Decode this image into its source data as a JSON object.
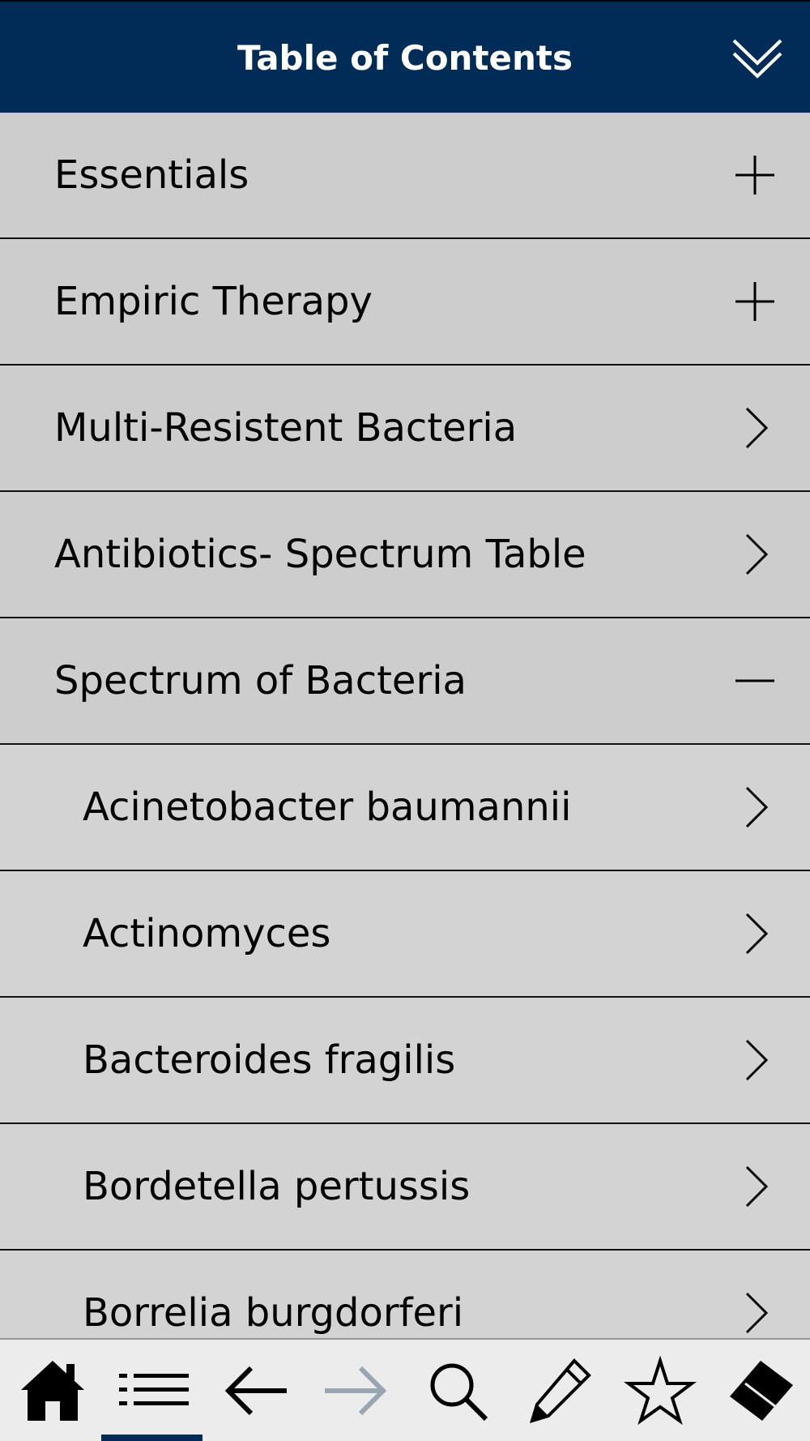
{
  "header": {
    "title": "Table of Contents",
    "collapse_icon": "double-chevron-down-icon"
  },
  "colors": {
    "header_bg": "#002c57",
    "header_text": "#ffffff",
    "row_bg": "#d3d3d3",
    "row_text": "#000000",
    "disabled_icon": "#9aa6b2",
    "active_indicator": "#002c57"
  },
  "toc": {
    "items": [
      {
        "label": "Essentials",
        "level": "top",
        "icon": "plus-icon"
      },
      {
        "label": "Empiric Therapy",
        "level": "top",
        "icon": "plus-icon"
      },
      {
        "label": "Multi-Resistent Bacteria",
        "level": "top",
        "icon": "chevron-right-icon"
      },
      {
        "label": "Antibiotics- Spectrum Table",
        "level": "top",
        "icon": "chevron-right-icon"
      },
      {
        "label": "Spectrum of Bacteria",
        "level": "top",
        "icon": "minus-icon"
      },
      {
        "label": "Acinetobacter baumannii",
        "level": "sub",
        "icon": "chevron-right-icon"
      },
      {
        "label": "Actinomyces",
        "level": "sub",
        "icon": "chevron-right-icon"
      },
      {
        "label": "Bacteroides fragilis",
        "level": "sub",
        "icon": "chevron-right-icon"
      },
      {
        "label": "Bordetella pertussis",
        "level": "sub",
        "icon": "chevron-right-icon"
      },
      {
        "label": "Borrelia burgdorferi",
        "level": "sub",
        "icon": "chevron-right-icon"
      }
    ]
  },
  "toolbar": {
    "items": [
      {
        "icon": "home-icon",
        "state": "enabled"
      },
      {
        "icon": "list-icon",
        "state": "active"
      },
      {
        "icon": "arrow-left-icon",
        "state": "enabled"
      },
      {
        "icon": "arrow-right-icon",
        "state": "disabled"
      },
      {
        "icon": "search-icon",
        "state": "enabled"
      },
      {
        "icon": "pencil-icon",
        "state": "enabled"
      },
      {
        "icon": "star-icon",
        "state": "enabled"
      },
      {
        "icon": "eraser-icon",
        "state": "enabled"
      }
    ]
  }
}
